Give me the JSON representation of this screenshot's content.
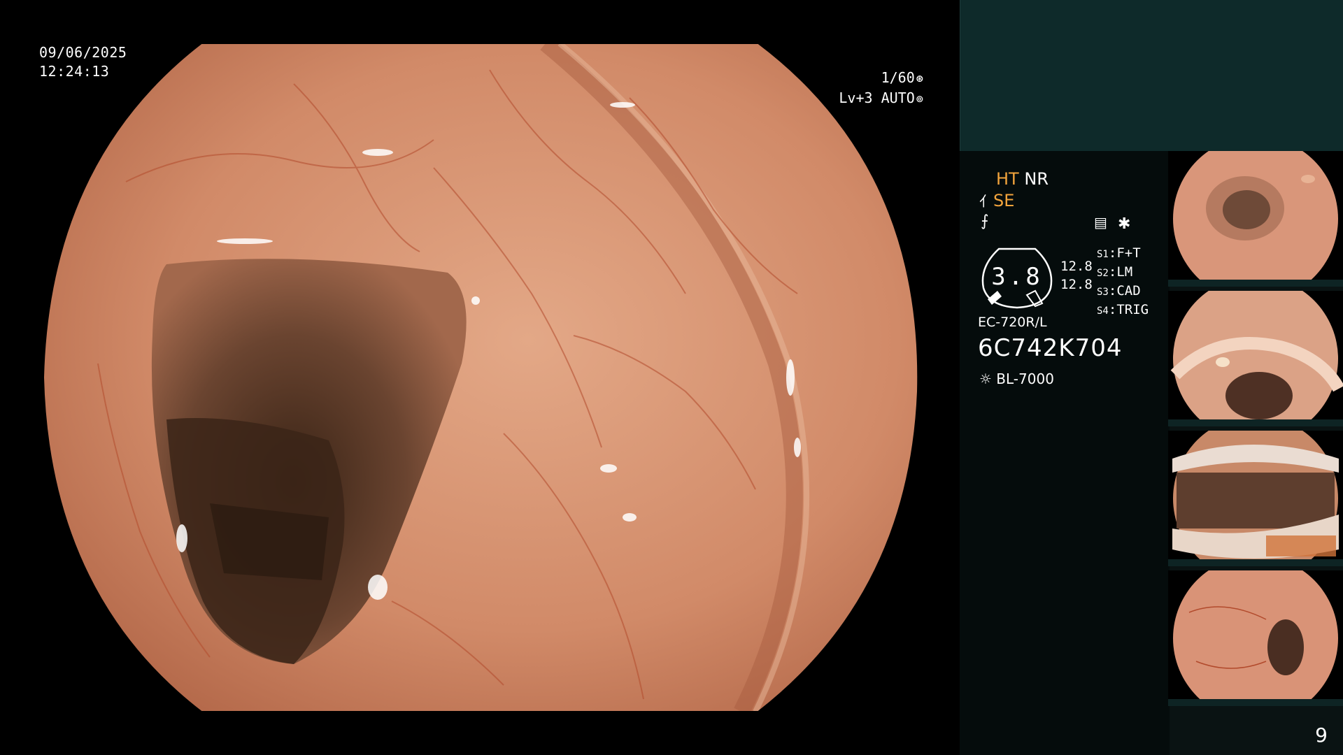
{
  "main_view": {
    "date": "09/06/2025",
    "time": "12:24:13",
    "shutter": "1/60",
    "level_mode": "Lv+3 AUTO",
    "image_description": "colonoscopy view of colon lumen with haustral folds and vascular pattern"
  },
  "settings": {
    "ht": "HT",
    "nr": "NR",
    "se": "SE",
    "accent_color": "#f2a43c"
  },
  "gauge": {
    "value": "3.8",
    "rate_top": "12.8",
    "rate_bottom": "12.8"
  },
  "switches": [
    {
      "key": "S1",
      "value": "F+T"
    },
    {
      "key": "S2",
      "value": "LM"
    },
    {
      "key": "S3",
      "value": "CAD"
    },
    {
      "key": "S4",
      "value": "TRIG"
    }
  ],
  "scope": {
    "model": "EC-720R/L",
    "serial": "6C742K704",
    "light_source": "BL-7000"
  },
  "icons": [
    "shutter-icon",
    "auto-iris-icon",
    "enhance-icon",
    "filter-icon",
    "settings-icon",
    "asterisk-icon",
    "light-icon"
  ],
  "thumbnails": [
    {
      "label": "captured-image-1"
    },
    {
      "label": "captured-image-2"
    },
    {
      "label": "captured-image-3"
    },
    {
      "label": "captured-image-4"
    }
  ],
  "page_number": "9"
}
